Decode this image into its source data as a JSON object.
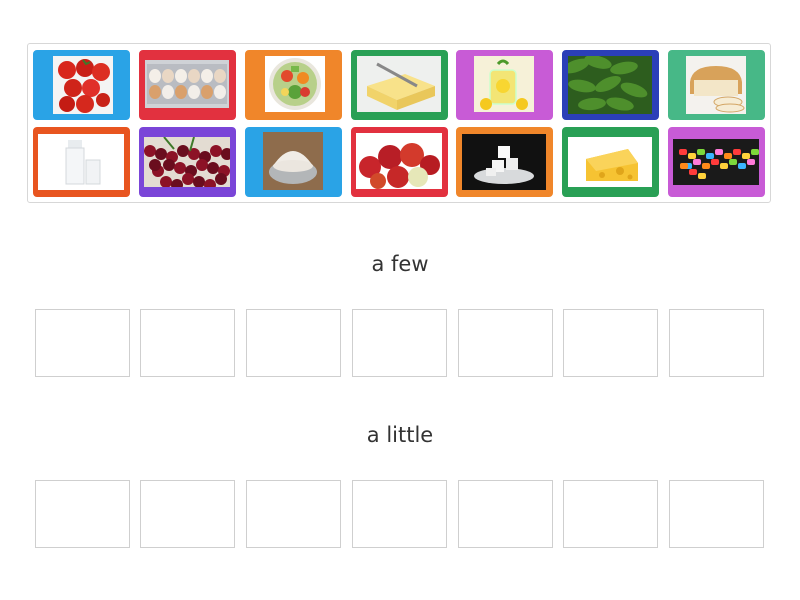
{
  "activity": {
    "cards": [
      {
        "name": "tomatoes-card",
        "image": "tomatoes",
        "frame": "#2aa3e6"
      },
      {
        "name": "eggs-card",
        "image": "eggs",
        "frame": "#e2313f"
      },
      {
        "name": "vegetables-card",
        "image": "vegetable-plate",
        "frame": "#f0862a"
      },
      {
        "name": "butter-card",
        "image": "butter",
        "frame": "#29a055"
      },
      {
        "name": "lemonade-card",
        "image": "lemonade",
        "frame": "#c85bd6"
      },
      {
        "name": "cucumbers-card",
        "image": "cucumbers",
        "frame": "#2b3fb8"
      },
      {
        "name": "bread-card",
        "image": "bread",
        "frame": "#47b887"
      },
      {
        "name": "milk-card",
        "image": "milk",
        "frame": "#e85520"
      },
      {
        "name": "cherries-card",
        "image": "cherries",
        "frame": "#7a45d8"
      },
      {
        "name": "flour-card",
        "image": "flour",
        "frame": "#2aa3e6"
      },
      {
        "name": "apples-card",
        "image": "apples",
        "frame": "#e2313f"
      },
      {
        "name": "sugar-card",
        "image": "sugar-cubes",
        "frame": "#f0862a"
      },
      {
        "name": "cheese-card",
        "image": "cheese",
        "frame": "#29a055"
      },
      {
        "name": "candy-card",
        "image": "candy",
        "frame": "#c85bd6"
      }
    ],
    "groups": [
      {
        "label": "a few",
        "slots": 7
      },
      {
        "label": "a little",
        "slots": 7
      }
    ]
  }
}
